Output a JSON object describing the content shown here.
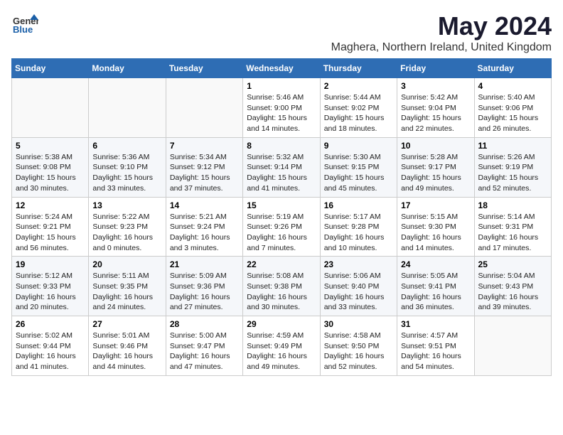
{
  "header": {
    "logo_general": "General",
    "logo_blue": "Blue",
    "main_title": "May 2024",
    "subtitle": "Maghera, Northern Ireland, United Kingdom"
  },
  "days_of_week": [
    "Sunday",
    "Monday",
    "Tuesday",
    "Wednesday",
    "Thursday",
    "Friday",
    "Saturday"
  ],
  "weeks": [
    [
      {
        "day": "",
        "content": ""
      },
      {
        "day": "",
        "content": ""
      },
      {
        "day": "",
        "content": ""
      },
      {
        "day": "1",
        "content": "Sunrise: 5:46 AM\nSunset: 9:00 PM\nDaylight: 15 hours\nand 14 minutes."
      },
      {
        "day": "2",
        "content": "Sunrise: 5:44 AM\nSunset: 9:02 PM\nDaylight: 15 hours\nand 18 minutes."
      },
      {
        "day": "3",
        "content": "Sunrise: 5:42 AM\nSunset: 9:04 PM\nDaylight: 15 hours\nand 22 minutes."
      },
      {
        "day": "4",
        "content": "Sunrise: 5:40 AM\nSunset: 9:06 PM\nDaylight: 15 hours\nand 26 minutes."
      }
    ],
    [
      {
        "day": "5",
        "content": "Sunrise: 5:38 AM\nSunset: 9:08 PM\nDaylight: 15 hours\nand 30 minutes."
      },
      {
        "day": "6",
        "content": "Sunrise: 5:36 AM\nSunset: 9:10 PM\nDaylight: 15 hours\nand 33 minutes."
      },
      {
        "day": "7",
        "content": "Sunrise: 5:34 AM\nSunset: 9:12 PM\nDaylight: 15 hours\nand 37 minutes."
      },
      {
        "day": "8",
        "content": "Sunrise: 5:32 AM\nSunset: 9:14 PM\nDaylight: 15 hours\nand 41 minutes."
      },
      {
        "day": "9",
        "content": "Sunrise: 5:30 AM\nSunset: 9:15 PM\nDaylight: 15 hours\nand 45 minutes."
      },
      {
        "day": "10",
        "content": "Sunrise: 5:28 AM\nSunset: 9:17 PM\nDaylight: 15 hours\nand 49 minutes."
      },
      {
        "day": "11",
        "content": "Sunrise: 5:26 AM\nSunset: 9:19 PM\nDaylight: 15 hours\nand 52 minutes."
      }
    ],
    [
      {
        "day": "12",
        "content": "Sunrise: 5:24 AM\nSunset: 9:21 PM\nDaylight: 15 hours\nand 56 minutes."
      },
      {
        "day": "13",
        "content": "Sunrise: 5:22 AM\nSunset: 9:23 PM\nDaylight: 16 hours\nand 0 minutes."
      },
      {
        "day": "14",
        "content": "Sunrise: 5:21 AM\nSunset: 9:24 PM\nDaylight: 16 hours\nand 3 minutes."
      },
      {
        "day": "15",
        "content": "Sunrise: 5:19 AM\nSunset: 9:26 PM\nDaylight: 16 hours\nand 7 minutes."
      },
      {
        "day": "16",
        "content": "Sunrise: 5:17 AM\nSunset: 9:28 PM\nDaylight: 16 hours\nand 10 minutes."
      },
      {
        "day": "17",
        "content": "Sunrise: 5:15 AM\nSunset: 9:30 PM\nDaylight: 16 hours\nand 14 minutes."
      },
      {
        "day": "18",
        "content": "Sunrise: 5:14 AM\nSunset: 9:31 PM\nDaylight: 16 hours\nand 17 minutes."
      }
    ],
    [
      {
        "day": "19",
        "content": "Sunrise: 5:12 AM\nSunset: 9:33 PM\nDaylight: 16 hours\nand 20 minutes."
      },
      {
        "day": "20",
        "content": "Sunrise: 5:11 AM\nSunset: 9:35 PM\nDaylight: 16 hours\nand 24 minutes."
      },
      {
        "day": "21",
        "content": "Sunrise: 5:09 AM\nSunset: 9:36 PM\nDaylight: 16 hours\nand 27 minutes."
      },
      {
        "day": "22",
        "content": "Sunrise: 5:08 AM\nSunset: 9:38 PM\nDaylight: 16 hours\nand 30 minutes."
      },
      {
        "day": "23",
        "content": "Sunrise: 5:06 AM\nSunset: 9:40 PM\nDaylight: 16 hours\nand 33 minutes."
      },
      {
        "day": "24",
        "content": "Sunrise: 5:05 AM\nSunset: 9:41 PM\nDaylight: 16 hours\nand 36 minutes."
      },
      {
        "day": "25",
        "content": "Sunrise: 5:04 AM\nSunset: 9:43 PM\nDaylight: 16 hours\nand 39 minutes."
      }
    ],
    [
      {
        "day": "26",
        "content": "Sunrise: 5:02 AM\nSunset: 9:44 PM\nDaylight: 16 hours\nand 41 minutes."
      },
      {
        "day": "27",
        "content": "Sunrise: 5:01 AM\nSunset: 9:46 PM\nDaylight: 16 hours\nand 44 minutes."
      },
      {
        "day": "28",
        "content": "Sunrise: 5:00 AM\nSunset: 9:47 PM\nDaylight: 16 hours\nand 47 minutes."
      },
      {
        "day": "29",
        "content": "Sunrise: 4:59 AM\nSunset: 9:49 PM\nDaylight: 16 hours\nand 49 minutes."
      },
      {
        "day": "30",
        "content": "Sunrise: 4:58 AM\nSunset: 9:50 PM\nDaylight: 16 hours\nand 52 minutes."
      },
      {
        "day": "31",
        "content": "Sunrise: 4:57 AM\nSunset: 9:51 PM\nDaylight: 16 hours\nand 54 minutes."
      },
      {
        "day": "",
        "content": ""
      }
    ]
  ]
}
